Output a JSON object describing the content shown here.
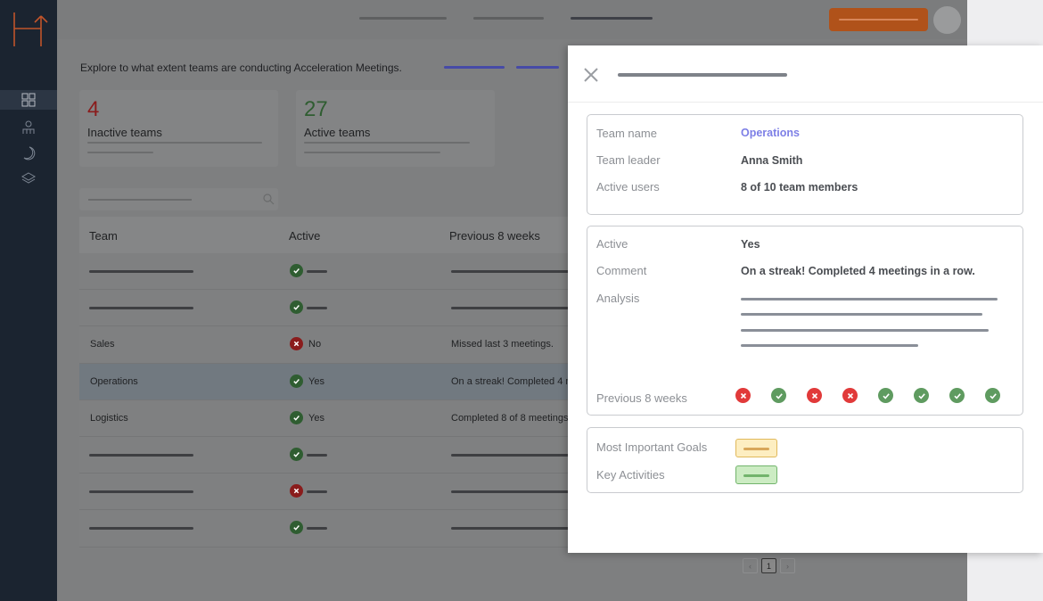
{
  "intro": {
    "text": "Explore to what extent teams are conducting Acceleration Meetings."
  },
  "stats": [
    {
      "value": "4",
      "label": "Inactive teams",
      "color": "#8a1c1c"
    },
    {
      "value": "27",
      "label": "Active teams",
      "color": "#2f5d31"
    }
  ],
  "table": {
    "headers": [
      "Team",
      "Active",
      "Previous 8 weeks"
    ],
    "rows": [
      {
        "team": "",
        "status": "ok",
        "active": "",
        "prev": ""
      },
      {
        "team": "",
        "status": "ok",
        "active": "",
        "prev": ""
      },
      {
        "team": "Sales",
        "status": "bad",
        "active": "No",
        "prev": "Missed last 3 meetings."
      },
      {
        "team": "Operations",
        "status": "ok",
        "active": "Yes",
        "prev": "On a streak! Completed 4 m"
      },
      {
        "team": "Logistics",
        "status": "ok",
        "active": "Yes",
        "prev": "Completed 8 of 8 meetings."
      },
      {
        "team": "",
        "status": "ok",
        "active": "",
        "prev": ""
      },
      {
        "team": "",
        "status": "bad",
        "active": "",
        "prev": ""
      },
      {
        "team": "",
        "status": "ok",
        "active": "",
        "prev": ""
      }
    ]
  },
  "pagination": {
    "prev": "‹",
    "current": "1",
    "next": "›"
  },
  "panel": {
    "team_name_label": "Team name",
    "team_name": "Operations",
    "team_leader_label": "Team leader",
    "team_leader": "Anna Smith",
    "active_users_label": "Active users",
    "active_users": "8 of 10 team members",
    "active_label": "Active",
    "active": "Yes",
    "comment_label": "Comment",
    "comment": "On a streak! Completed 4 meetings in a row.",
    "analysis_label": "Analysis",
    "prev_weeks_label": "Previous 8 weeks",
    "prev_weeks": [
      "bad",
      "ok",
      "bad",
      "bad",
      "ok",
      "ok",
      "ok",
      "ok"
    ],
    "goals_label": "Most Important Goals",
    "activities_label": "Key Activities"
  },
  "icons": {
    "sidebar": [
      "dashboard-icon",
      "teams-icon",
      "moon-icon",
      "layers-icon"
    ],
    "search": "search-icon",
    "close": "close-icon"
  },
  "colors": {
    "accent": "#7d7fe6",
    "cta": "#b0521a",
    "ok": "#5f9b60",
    "bad": "#e13a3a",
    "sidebar": "#1b2430"
  }
}
